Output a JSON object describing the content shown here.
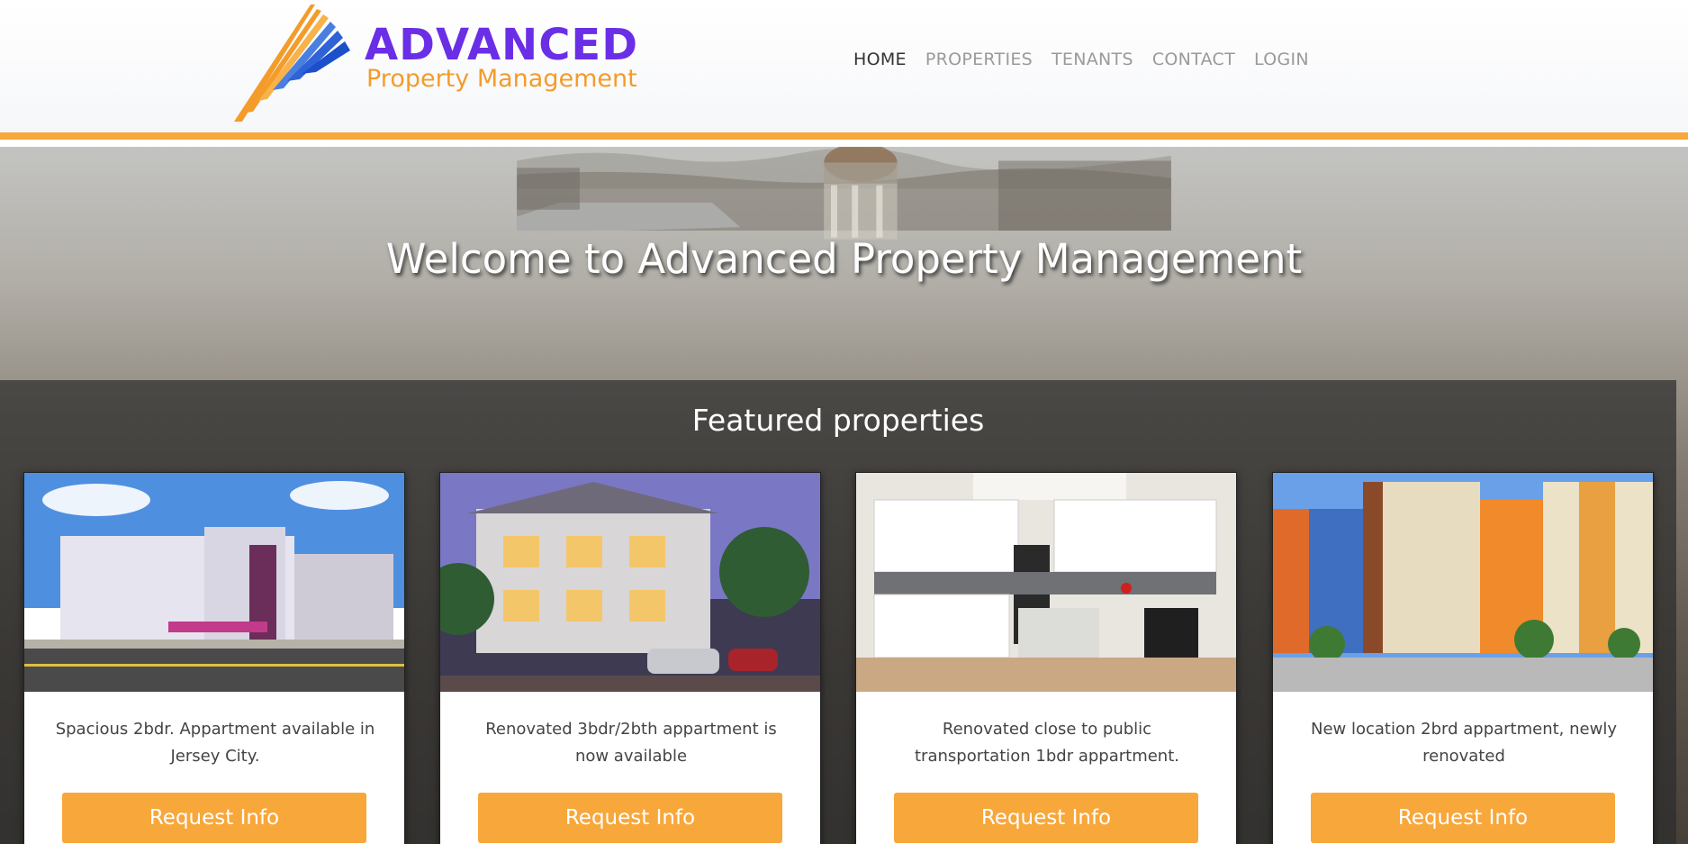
{
  "header": {
    "logo_title": "ADVANCED",
    "logo_subtitle": "Property Management",
    "nav": [
      {
        "label": "HOME"
      },
      {
        "label": "PROPERTIES"
      },
      {
        "label": "TENANTS"
      },
      {
        "label": "CONTACT"
      },
      {
        "label": "LOGIN"
      }
    ]
  },
  "hero": {
    "title": "Welcome to Advanced Property Management"
  },
  "featured": {
    "title": "Featured properties",
    "cards": [
      {
        "description": "Spacious 2bdr. Appartment available in Jersey City.",
        "button": "Request Info"
      },
      {
        "description": "Renovated 3bdr/2bth appartment is now available",
        "button": "Request Info"
      },
      {
        "description": "Renovated close to public transportation 1bdr appartment.",
        "button": "Request Info"
      },
      {
        "description": "New location 2brd appartment, newly renovated",
        "button": "Request Info"
      }
    ]
  },
  "colors": {
    "accent": "#f8a73a",
    "logo_purple": "#6a2ee6",
    "logo_orange": "#f39c2a"
  }
}
